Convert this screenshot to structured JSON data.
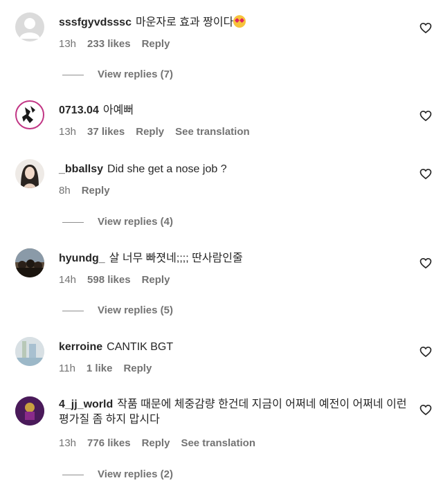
{
  "comments": [
    {
      "username": "sssfgyvdsssc",
      "text": "마운자로 효과 짱이다",
      "emoji": "heart-eyes-emoji",
      "time": "13h",
      "likes": "233 likes",
      "reply": "Reply",
      "translation": "",
      "view_replies": "View replies (7)"
    },
    {
      "username": "0713.04",
      "text": "아예뻐",
      "time": "13h",
      "likes": "37 likes",
      "reply": "Reply",
      "translation": "See translation",
      "view_replies": ""
    },
    {
      "username": "_bballsy",
      "text": "Did she get a nose job ?",
      "time": "8h",
      "likes": "",
      "reply": "Reply",
      "translation": "",
      "view_replies": "View replies (4)"
    },
    {
      "username": "hyundg_",
      "text": "살 너무 빠졋네;;;; 딴사람인줄",
      "time": "14h",
      "likes": "598 likes",
      "reply": "Reply",
      "translation": "",
      "view_replies": "View replies (5)"
    },
    {
      "username": "kerroine",
      "text": "CANTIK BGT",
      "time": "11h",
      "likes": "1 like",
      "reply": "Reply",
      "translation": "",
      "view_replies": ""
    },
    {
      "username": "4_jj_world",
      "text": "작품 때문에 체중감량 한건데 지금이 어쩌네 예전이 어쩌네 이런 평가질 좀 하지 맙시다",
      "time": "13h",
      "likes": "776 likes",
      "reply": "Reply",
      "translation": "See translation",
      "view_replies": "View replies (2)"
    }
  ],
  "icons": {
    "like": "heart-outline-icon",
    "default_avatar": "default-avatar-icon"
  },
  "colors": {
    "text": "#262626",
    "secondary": "#737373",
    "background": "#ffffff"
  }
}
